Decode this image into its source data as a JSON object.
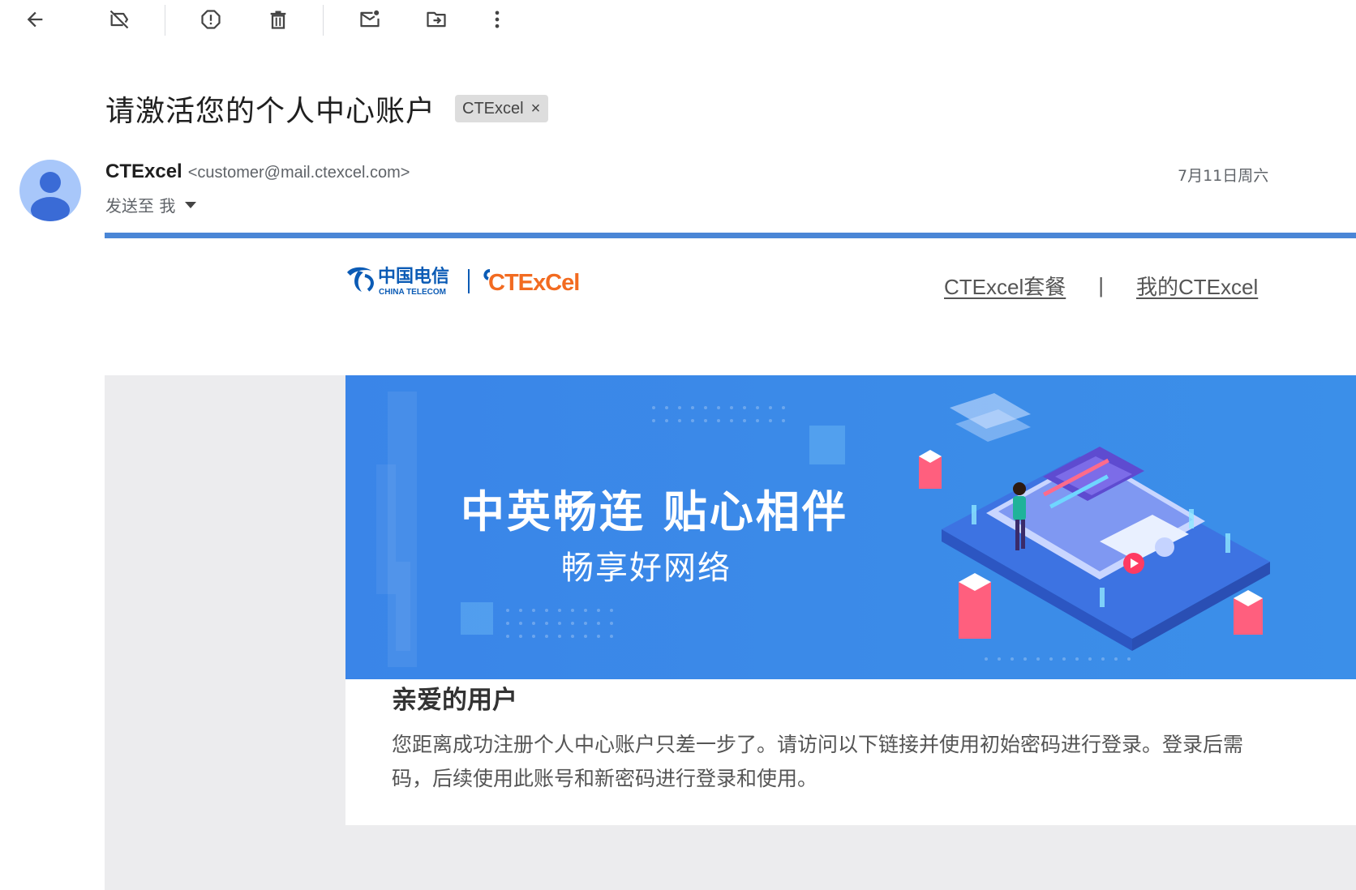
{
  "toolbar": {
    "icons": [
      "back-arrow-icon",
      "label-off-icon",
      "report-spam-icon",
      "delete-icon",
      "mark-unread-icon",
      "move-to-icon",
      "more-vert-icon"
    ]
  },
  "email": {
    "subject": "请激活您的个人中心账户",
    "label": "CTExcel",
    "label_remove": "×",
    "sender_name": "CTExcel",
    "sender_email": "<customer@mail.ctexcel.com>",
    "recipient": "发送至 我",
    "date": "7月11日周六"
  },
  "body": {
    "brand": {
      "china_telecom_cn": "中国电信",
      "china_telecom_en": "CHINA TELECOM",
      "ctexcel_logo": "CTExCel"
    },
    "nav": {
      "plans": "CTExcel套餐",
      "separator": "|",
      "my_account": "我的CTExcel"
    },
    "banner": {
      "title": "中英畅连 贴心相伴",
      "subtitle": "畅享好网络"
    },
    "greeting": "亲爱的用户",
    "paragraph_line1": "您距离成功注册个人中心账户只差一步了。请访问以下链接并使用初始密码进行登录。登录后需",
    "paragraph_line2": "码，后续使用此账号和新密码进行登录和使用。"
  },
  "colors": {
    "accent_rule": "#4a86d6",
    "banner_blue": "#3b8ae8",
    "telecom_blue": "#0b5bb5",
    "ctexcel_orange": "#f26b21",
    "avatar_bg": "#a8c7fa",
    "avatar_fg": "#3a6bd6"
  }
}
